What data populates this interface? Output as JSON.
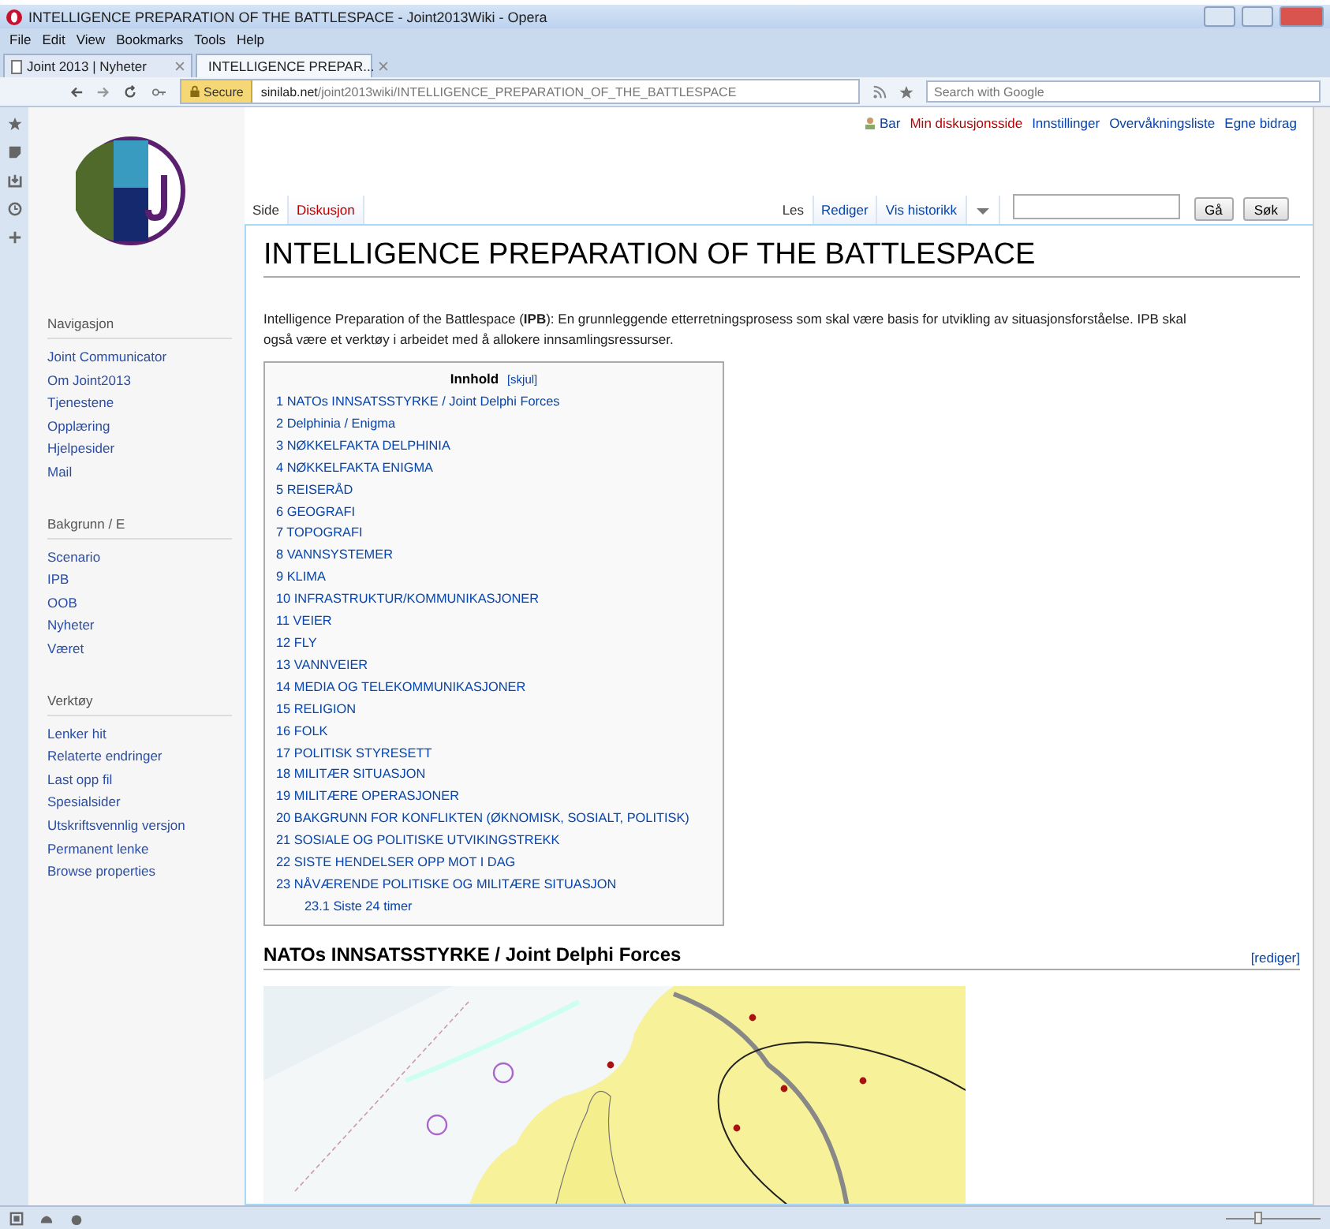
{
  "browser": {
    "title": "INTELLIGENCE PREPARATION OF THE BATTLESPACE - Joint2013Wiki - Opera",
    "menu": [
      "File",
      "Edit",
      "View",
      "Bookmarks",
      "Tools",
      "Help"
    ],
    "tabs": [
      {
        "label": "Joint 2013 | Nyheter",
        "selected": false
      },
      {
        "label": "INTELLIGENCE PREPAR...",
        "selected": true
      }
    ],
    "address": {
      "secure_label": "Secure",
      "host": "sinilab.net",
      "path": "/joint2013wiki/INTELLIGENCE_PREPARATION_OF_THE_BATTLESPACE"
    },
    "search": {
      "placeholder": "Search with Google"
    },
    "zoom": {
      "level": 0.35
    }
  },
  "personal_tools": [
    {
      "label": "Bar",
      "kind": "user",
      "missing": false
    },
    {
      "label": "Min diskusjonsside",
      "kind": "link",
      "missing": true
    },
    {
      "label": "Innstillinger",
      "kind": "link",
      "missing": false
    },
    {
      "label": "Overvåkningsliste",
      "kind": "link",
      "missing": false
    },
    {
      "label": "Egne bidrag",
      "kind": "link",
      "missing": false
    }
  ],
  "namespaces": [
    {
      "label": "Side",
      "selected": true,
      "missing": false
    },
    {
      "label": "Diskusjon",
      "selected": false,
      "missing": true
    }
  ],
  "views": [
    {
      "label": "Les",
      "selected": true
    },
    {
      "label": "Rediger",
      "selected": false
    },
    {
      "label": "Vis historikk",
      "selected": false
    }
  ],
  "search": {
    "go": "Gå",
    "search": "Søk"
  },
  "sidebar": [
    {
      "heading": "Navigasjon",
      "items": [
        "Joint Communicator",
        "Om Joint2013",
        "Tjenestene",
        "Opplæring",
        "Hjelpesider",
        "Mail"
      ]
    },
    {
      "heading": "Bakgrunn / E",
      "items": [
        "Scenario",
        "IPB",
        "OOB",
        "Nyheter",
        "Været"
      ]
    },
    {
      "heading": "Verktøy",
      "items": [
        "Lenker hit",
        "Relaterte endringer",
        "Last opp fil",
        "Spesialsider",
        "Utskriftsvennlig versjon",
        "Permanent lenke",
        "Browse properties"
      ]
    }
  ],
  "page": {
    "title": "INTELLIGENCE PREPARATION OF THE BATTLESPACE",
    "intro": "Intelligence Preparation of the Battlespace (**IPB**): En grunnleggende etterretningsprosess som skal være basis for utvikling av situasjonsforståelse. IPB skal også være et verktøy i arbeidet med å allokere innsamlingsressurser.",
    "toc": {
      "title": "Innhold",
      "toggle": "[skjul]",
      "entries": [
        {
          "label": "1 NATOs INNSATSSTYRKE / Joint Delphi Forces"
        },
        {
          "label": "2 Delphinia / Enigma"
        },
        {
          "label": "3 NØKKELFAKTA DELPHINIA"
        },
        {
          "label": "4 NØKKELFAKTA ENIGMA"
        },
        {
          "label": "5 REISERÅD"
        },
        {
          "label": "6 GEOGRAFI"
        },
        {
          "label": "7 TOPOGRAFI"
        },
        {
          "label": "8 VANNSYSTEMER"
        },
        {
          "label": "9 KLIMA"
        },
        {
          "label": "10 INFRASTRUKTUR/KOMMUNIKASJONER"
        },
        {
          "label": "11 VEIER"
        },
        {
          "label": "12 FLY"
        },
        {
          "label": "13 VANNVEIER"
        },
        {
          "label": "14 MEDIA OG TELEKOMMUNIKASJONER"
        },
        {
          "label": "15 RELIGION"
        },
        {
          "label": "16 FOLK"
        },
        {
          "label": "17 POLITISK STYRESETT"
        },
        {
          "label": "18 MILITÆR SITUASJON"
        },
        {
          "label": "19 MILITÆRE OPERASJONER"
        },
        {
          "label": "20 BAKGRUNN FOR KONFLIKTEN (ØKNOMISK, SOSIALT, POLITISK)"
        },
        {
          "label": "21 SOSIALE OG POLITISKE UTVIKINGSTREKK"
        },
        {
          "label": "22 SISTE HENDELSER OPP MOT I DAG"
        },
        {
          "label": "23 NÅVÆRENDE POLITISKE OG MILITÆRE SITUASJON",
          "children": [
            {
              "label": "23.1 Siste 24 timer"
            }
          ]
        }
      ]
    },
    "section": {
      "heading": "NATOs INNSATSSTYRKE / Joint Delphi Forces",
      "edit": "[rediger]"
    }
  }
}
